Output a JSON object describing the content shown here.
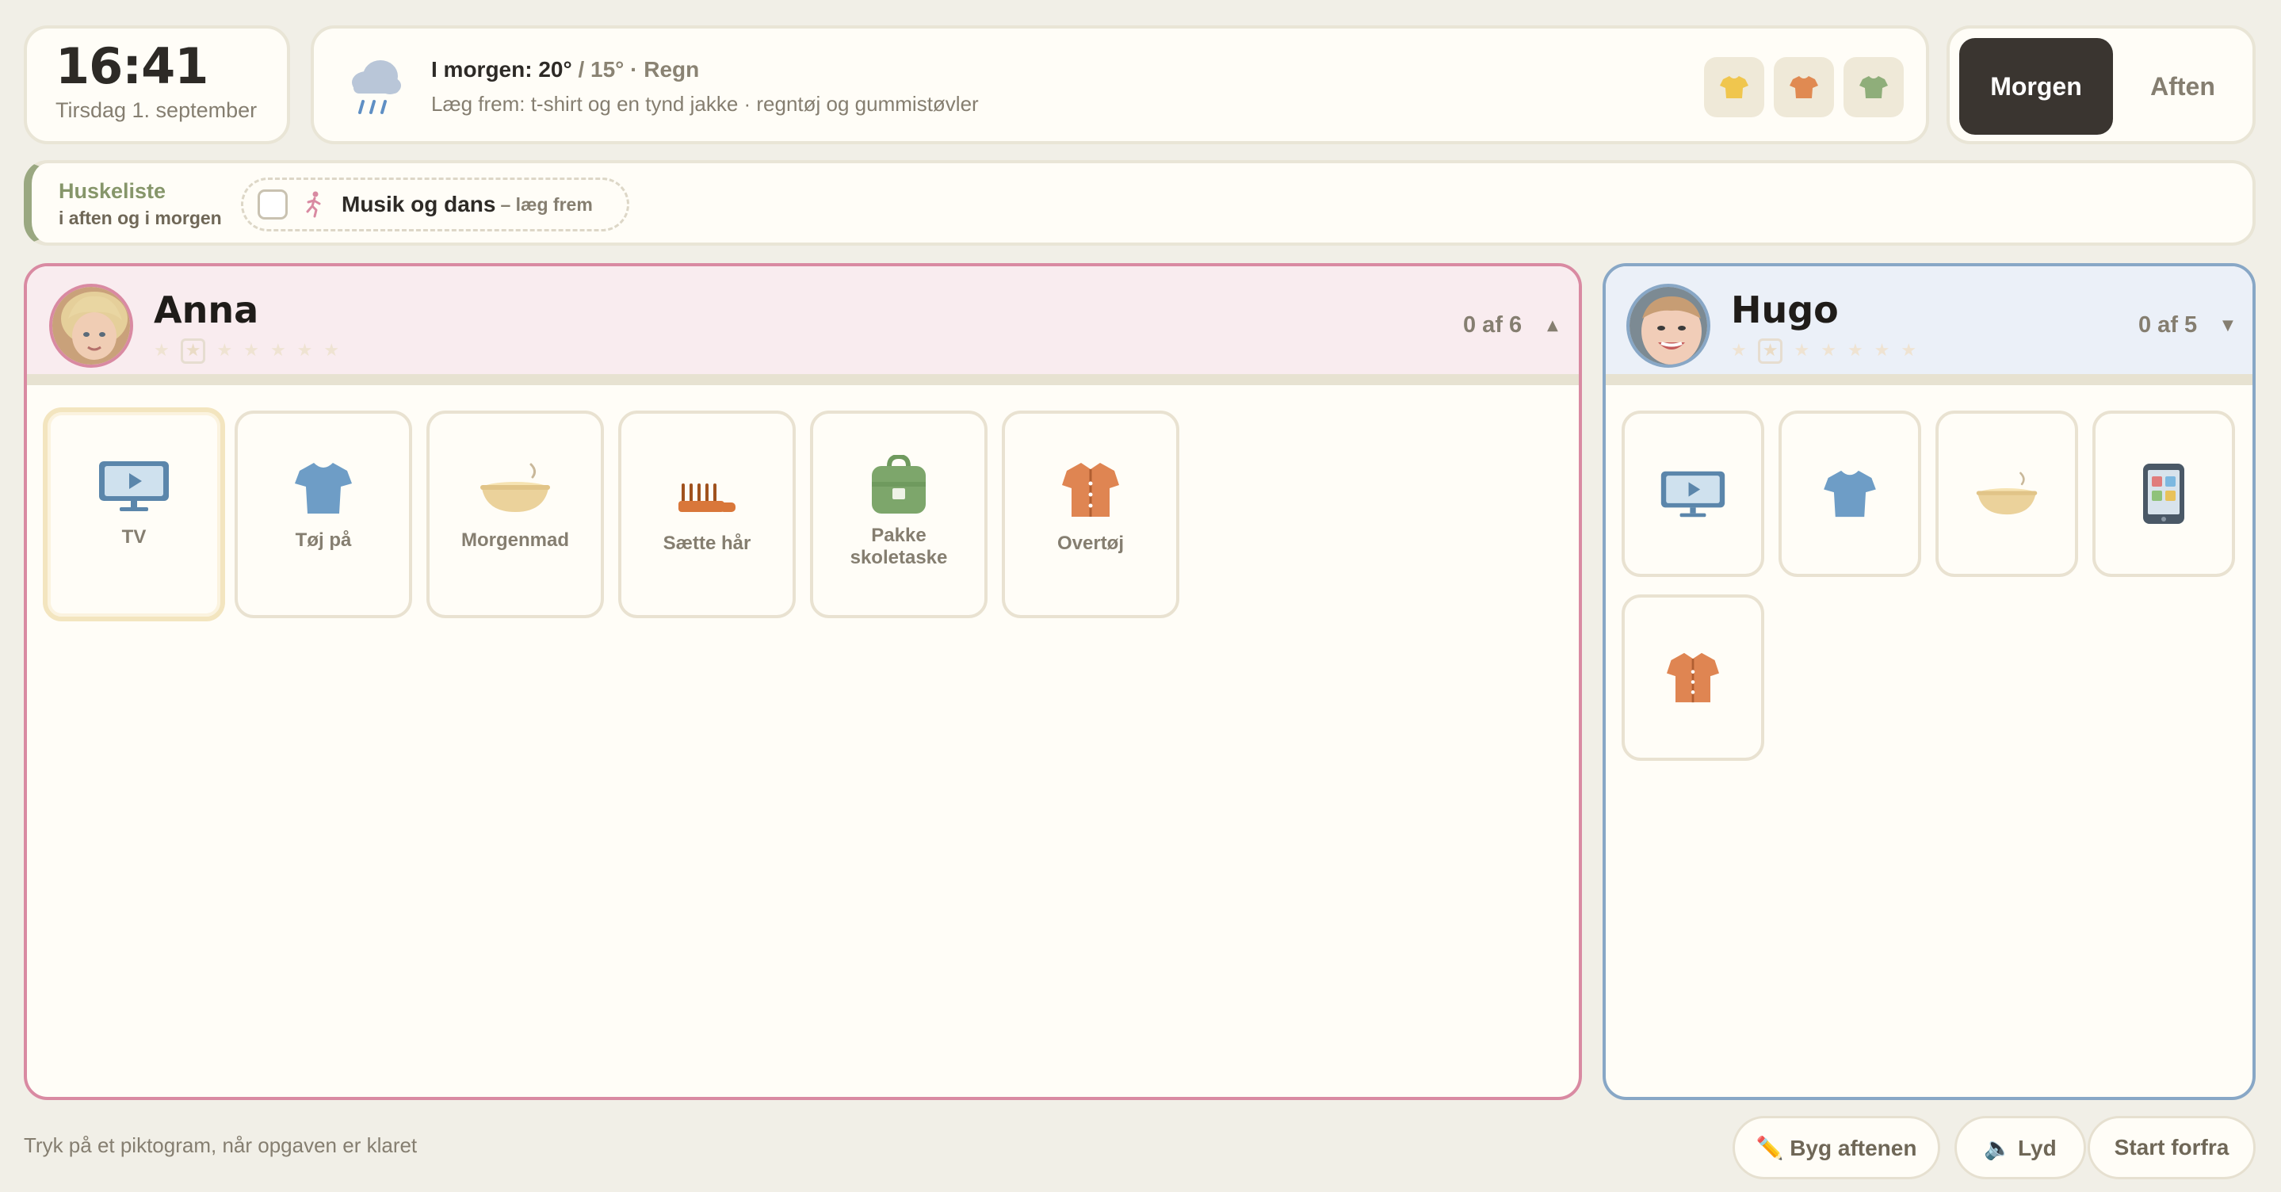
{
  "clock": {
    "time": "16:41",
    "date": "Tirsdag 1. september"
  },
  "weather": {
    "label": "I morgen: 20°",
    "low": "/ 15° · Regn",
    "advice": "Læg frem: t-shirt og en tynd jakke · regntøj og gummistøvler",
    "icon": "rain-cloud-icon",
    "shirts": [
      {
        "name": "yellow-shirt-icon",
        "color": "#f0c64e"
      },
      {
        "name": "orange-shirt-icon",
        "color": "#e08a52"
      },
      {
        "name": "green-shirt-icon",
        "color": "#8fae7a"
      }
    ]
  },
  "mode": {
    "active": "Morgen",
    "inactive": "Aften"
  },
  "reminder": {
    "title": "Huskeliste",
    "subtitle": "i aften og i morgen",
    "item_label": "Musik og dans",
    "item_note": "– læg frem"
  },
  "kids": {
    "anna": {
      "name": "Anna",
      "progress": "0 af 6",
      "caret": "▲",
      "accent": "#d98aa2",
      "tasks": [
        {
          "label": "TV"
        },
        {
          "label": "Tøj på"
        },
        {
          "label": "Morgenmad"
        },
        {
          "label": "Sætte hår"
        },
        {
          "label": "Pakke skoletaske"
        },
        {
          "label": "Overtøj"
        }
      ]
    },
    "hugo": {
      "name": "Hugo",
      "progress": "0 af 5",
      "caret": "▼",
      "accent": "#88a7c6"
    }
  },
  "footer": {
    "hint": "Tryk på et piktogram, når opgaven er klaret",
    "build_label": "✏️ Byg aftenen",
    "sound_label": "🔈 Lyd",
    "restart_label": "Start forfra"
  }
}
